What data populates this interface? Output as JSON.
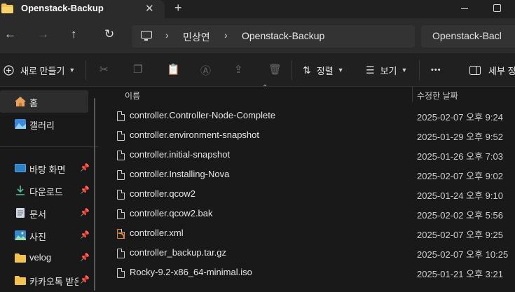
{
  "window": {
    "tab_title": "Openstack-Backup",
    "close_glyph": "✕",
    "new_tab_glyph": "+"
  },
  "address_bar": {
    "breadcrumbs": [
      "민상연",
      "Openstack-Backup"
    ],
    "separator": "›",
    "search_value": "Openstack-Bacl"
  },
  "nav": {
    "back": "←",
    "forward": "→",
    "up": "↑",
    "refresh": "↻"
  },
  "toolbar": {
    "new_label": "새로 만들기",
    "sort_label": "정렬",
    "view_label": "보기",
    "more_label": "•••",
    "details_label": "세부 정"
  },
  "sidebar": {
    "items": [
      {
        "label": "홈",
        "icon": "home-icon"
      },
      {
        "label": "갤러리",
        "icon": "gallery-icon"
      },
      {
        "label": "바탕 화면",
        "icon": "desktop-folder-icon",
        "pinned": true
      },
      {
        "label": "다운로드",
        "icon": "download-icon",
        "pinned": true
      },
      {
        "label": "문서",
        "icon": "document-icon",
        "pinned": true
      },
      {
        "label": "사진",
        "icon": "pictures-icon",
        "pinned": true
      },
      {
        "label": "velog",
        "icon": "folder-icon",
        "pinned": true
      },
      {
        "label": "카카오톡 받은",
        "icon": "folder-icon",
        "pinned": true
      }
    ],
    "pin_glyph": "📌"
  },
  "columns": {
    "name": "이름",
    "modified": "수정한 날짜"
  },
  "files": [
    {
      "name": "controller.Controller-Node-Complete",
      "date": "2025-02-07 오후 9:24",
      "type": "file"
    },
    {
      "name": "controller.environment-snapshot",
      "date": "2025-01-29 오후 9:52",
      "type": "file"
    },
    {
      "name": "controller.initial-snapshot",
      "date": "2025-01-26 오후 7:03",
      "type": "file"
    },
    {
      "name": "controller.Installing-Nova",
      "date": "2025-02-07 오후 9:02",
      "type": "file"
    },
    {
      "name": "controller.qcow2",
      "date": "2025-01-24 오후 9:10",
      "type": "file"
    },
    {
      "name": "controller.qcow2.bak",
      "date": "2025-02-02 오후 5:56",
      "type": "file"
    },
    {
      "name": "controller.xml",
      "date": "2025-02-07 오후 9:25",
      "type": "xml"
    },
    {
      "name": "controller_backup.tar.gz",
      "date": "2025-02-07 오후 10:25",
      "type": "file"
    },
    {
      "name": "Rocky-9.2-x86_64-minimal.iso",
      "date": "2025-01-21 오후 3:21",
      "type": "file"
    }
  ],
  "colors": {
    "accent": "#f5c542",
    "background": "#191919",
    "toolbar": "#202020",
    "address_row": "#2b2b2b"
  }
}
